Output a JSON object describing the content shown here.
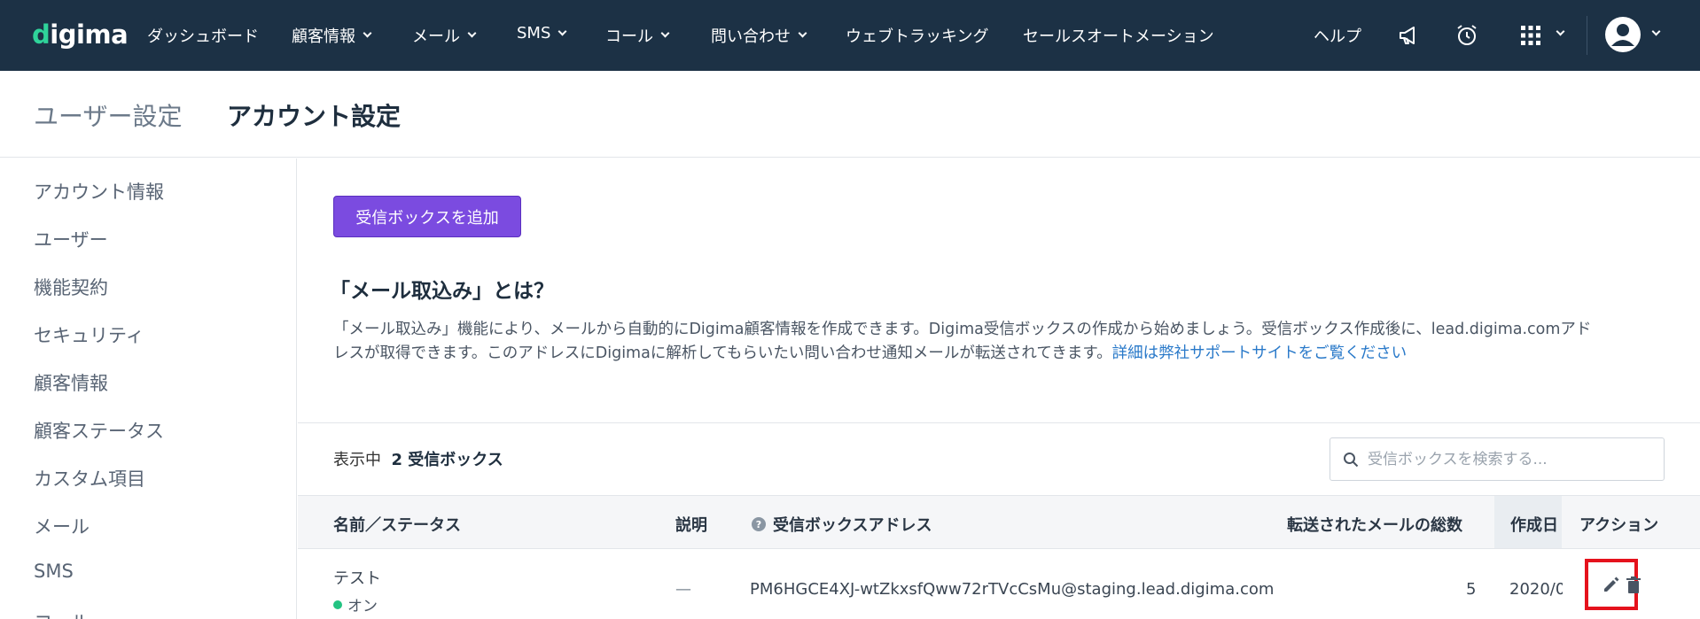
{
  "topnav": {
    "logo": "digima",
    "items": [
      {
        "label": "ダッシュボード",
        "dropdown": false
      },
      {
        "label": "顧客情報",
        "dropdown": true
      },
      {
        "label": "メール",
        "dropdown": true
      },
      {
        "label": "SMS",
        "dropdown": true
      },
      {
        "label": "コール",
        "dropdown": true
      },
      {
        "label": "問い合わせ",
        "dropdown": true
      },
      {
        "label": "ウェブトラッキング",
        "dropdown": false
      },
      {
        "label": "セールスオートメーション",
        "dropdown": false
      }
    ],
    "help": "ヘルプ",
    "icons": [
      "megaphone-icon",
      "alarm-clock-icon",
      "apps-grid-icon",
      "user-avatar-icon"
    ]
  },
  "header": {
    "parent": "ユーザー設定",
    "current": "アカウント設定"
  },
  "sidebar": {
    "items": [
      {
        "label": "アカウント情報"
      },
      {
        "label": "ユーザー"
      },
      {
        "label": "機能契約"
      },
      {
        "label": "セキュリティ"
      },
      {
        "label": "顧客情報"
      },
      {
        "label": "顧客ステータス"
      },
      {
        "label": "カスタム項目"
      },
      {
        "label": "メール"
      },
      {
        "label": "SMS"
      },
      {
        "label": "コール"
      }
    ]
  },
  "main": {
    "add_button": "受信ボックスを追加",
    "section_title": "「メール取込み」とは？",
    "desc_line1": "「メール取込み」機能により、メールから自動的にDigima顧客情報を作成できます。Digima受信ボックスの作成から始めましょう。受信ボックス作成後に、lead.digima.comアド",
    "desc_line2": "レスが取得できます。このアドレスにDigimaに解析してもらいたい問い合わせ通知メールが転送されてきます。",
    "desc_link": "詳細は弊社サポートサイトをご覧ください",
    "count_prefix": "表示中",
    "count_value": "2 受信ボックス",
    "search_placeholder": "受信ボックスを検索する..."
  },
  "table": {
    "columns": {
      "name": "名前／ステータス",
      "description": "説明",
      "address": "受信ボックスアドレス",
      "forwarded": "転送されたメールの総数",
      "created": "作成日",
      "actions": "アクション"
    },
    "rows": [
      {
        "name": "テスト",
        "status": "オン",
        "description": "—",
        "address": "PM6HGCE4XJ-wtZkxsfQww72rTVcCsMu@staging.lead.digima.com",
        "forwarded": "5",
        "created": "2020/0"
      }
    ]
  },
  "colors": {
    "nav_bg": "#1c3145",
    "accent_purple": "#7b4be0",
    "link_blue": "#2979c9",
    "status_green": "#23c382",
    "highlight_red": "#e5121c"
  }
}
